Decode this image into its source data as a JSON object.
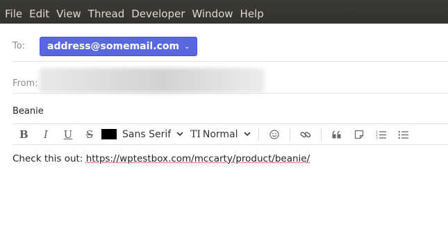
{
  "menubar": {
    "items": [
      "File",
      "Edit",
      "View",
      "Thread",
      "Developer",
      "Window",
      "Help"
    ]
  },
  "composer": {
    "to_label": "To:",
    "to_recipient": "address@somemail.com",
    "from_label": "From:",
    "subject": "Beanie",
    "body_prefix": "Check this out: ",
    "body_link": "https://wptestbox.com/mccarty/product/beanie/"
  },
  "toolbar": {
    "bold": "B",
    "italic": "I",
    "underline": "U",
    "strikethrough": "S",
    "text_color": "#000000",
    "font_family": "Sans Serif",
    "font_size_icon": "TI",
    "font_size": "Normal",
    "icons": [
      "emoji-icon",
      "link-icon",
      "quote-icon",
      "note-icon",
      "ordered-list-icon",
      "bullet-list-icon"
    ]
  },
  "colors": {
    "accent": "#5a68e0",
    "menubar": "#3b3a36",
    "spellcheck": "#d62020"
  }
}
